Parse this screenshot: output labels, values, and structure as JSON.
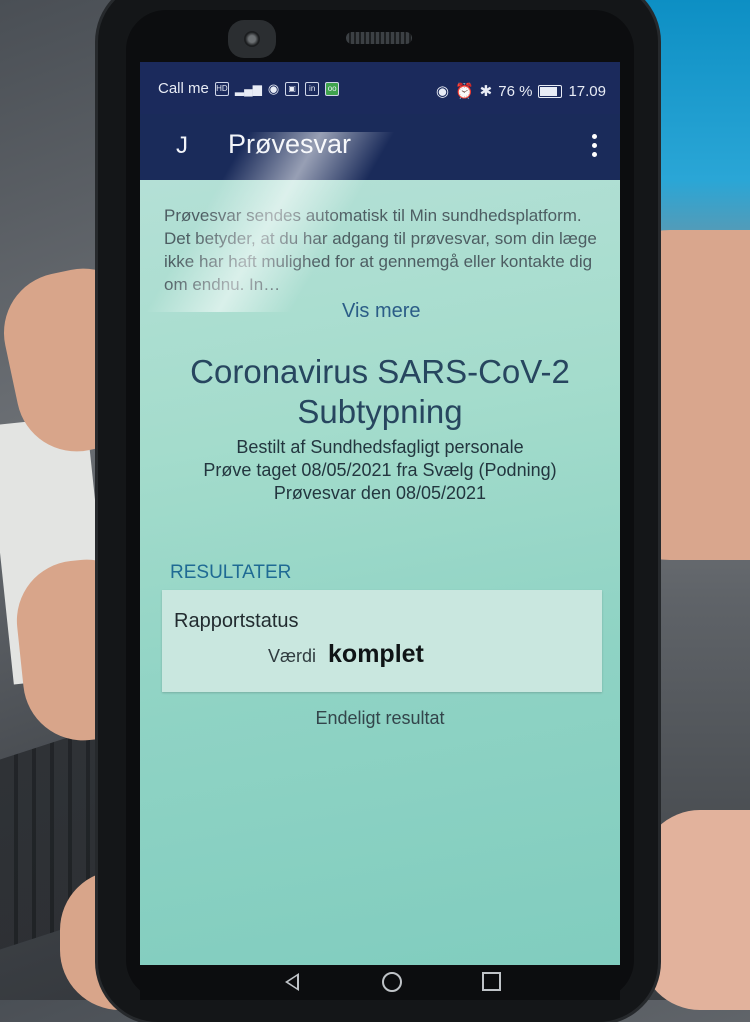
{
  "status_bar": {
    "carrier": "Call me",
    "indicators": [
      "HD",
      "4G",
      "signal",
      "wifi",
      "image",
      "linkedin",
      "app"
    ],
    "battery": "76 %",
    "time": "17.09"
  },
  "app_bar": {
    "avatar_letter": "J",
    "title": "Prøvesvar",
    "menu_icon": "overflow-menu-icon"
  },
  "intro": {
    "text": "Prøvesvar sendes automatisk til Min sundhedsplatform. Det betyder, at du har adgang til prøvesvar, som din læge ikke har haft mulighed for at gennemgå eller kontakte dig om endnu. In…",
    "more_link": "Vis mere"
  },
  "test": {
    "title_line1": "Coronavirus SARS-CoV-2",
    "title_line2": "Subtypning",
    "ordered_by": "Bestilt af Sundhedsfagligt personale",
    "sample_taken": "Prøve taget 08/05/2021 fra Svælg (Podning)",
    "result_date": "Prøvesvar den 08/05/2021"
  },
  "results": {
    "heading": "RESULTATER",
    "card_label": "Rapportstatus",
    "value_label": "Værdi",
    "value": "komplet",
    "final_note": "Endeligt resultat"
  },
  "nav": {
    "back_icon": "back-triangle-icon",
    "home_icon": "home-circle-icon",
    "recent_icon": "recent-square-icon"
  }
}
